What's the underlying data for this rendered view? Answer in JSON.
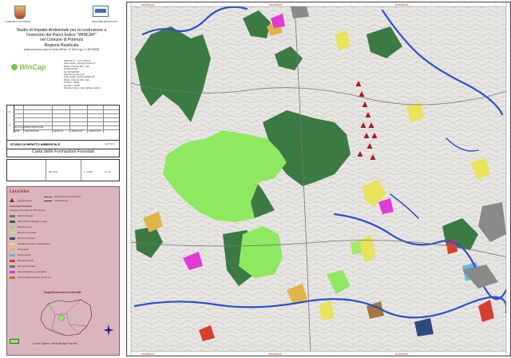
{
  "header": {
    "left_logo_caption": "COMUNE DI POTENZA",
    "right_logo_caption": "REGIONE BASILICATA",
    "title_lines": [
      "Studio di Impatto Ambientale per la costruzione e",
      "l'esercizio del Parco Eolico \"WINCAP\"",
      "nel Comune di Potenza",
      "Regione Basilicata"
    ],
    "title_sub": "(autorizzazione unica ai sensi dell'art. 12 del D.Lgs. n. 387/2003)"
  },
  "company": {
    "logo_text": "WinCap",
    "lines": [
      "WINCAP S.r.l. - EYA GROUP",
      "Sede Legale:   Via Pietro Fiorucci 8",
      "85100 - Potenza (PZ) - Italy",
      "Tel 0971/27697",
      "Fax 0971/27698",
      "",
      "Engineering Group Srl",
      "Sede Legale:   Via del Gallitello 89",
      "85100 - Potenza (PZ) - Italy",
      "Tel 0971 - 54201",
      "Fax 0971 - 50407",
      "Direttore Tecnico:  Dott. Raffaele Santoro"
    ]
  },
  "title_block": {
    "side_marks": [
      "0",
      "A"
    ],
    "rows": [
      {
        "date": "Marzo 2012",
        "desc": "PRIMA EMISSIONE"
      }
    ],
    "columns": [
      "DATA",
      "DESCRIZIONE",
      "REDATTO",
      "VERIFICATO",
      "APPROVATO"
    ],
    "doc_label": "STUDIO DI IMPATTO AMBIENTALE",
    "doc_code": "A.17.3.1",
    "drawing_title": "Carta delle Formazioni Forestali",
    "bottom": {
      "format": "594 x 841",
      "scale": "1 : 25.000",
      "sheet": "01 / 01"
    }
  },
  "legend": {
    "heading": "LEGENDA",
    "turbine_label": "Aerogeneratori",
    "forest_heading": "Formazioni Forestali",
    "forest_subheading": "Categorie Forestali del IFN Lucania",
    "items": [
      {
        "label": "Boschi di faggio",
        "color": "#4a8c3e"
      },
      {
        "label": "Altri boschi di latifoglie e misti",
        "color": "#2f6b34"
      },
      {
        "label": "Boschi di cerro",
        "color": "#8fd96b"
      },
      {
        "label": "Boschi di roverella",
        "color": "#a6e86a"
      },
      {
        "label": "Boschi di conifere",
        "color": "#2e4a7d"
      },
      {
        "label": "Arbusteti termofili e mediterranei",
        "color": "#e7e35a"
      },
      {
        "label": "Cespuglieti",
        "color": "#e0b449"
      },
      {
        "label": "Boschi igrofili",
        "color": "#5fb8e0"
      },
      {
        "label": "Rimboschimenti",
        "color": "#d63f2f"
      },
      {
        "label": "Formazioni riparie",
        "color": "#6f6f6f"
      },
      {
        "label": "Pascoli arborati e cespugliati",
        "color": "#e23ad6"
      },
      {
        "label": "Aree boscate percorse da incendi",
        "color": "#a07840"
      }
    ],
    "right_items": [
      "Elettrodotto interrato 36 kV",
      "Sottostazione"
    ],
    "inquadramento": "Inquadramento territoriale",
    "coord_system": "Coord. System: Gauss Boaga Fuso est"
  },
  "map_frame": {
    "top_labels": [
      "2570000.000",
      "2572000.000",
      "2574000.000"
    ],
    "bottom_labels": [
      "2570000.000",
      "2572000.000",
      "2574000.000"
    ],
    "left_labels": [
      "4506000.000",
      "4504000.000",
      "4502000.000",
      "4500000.000"
    ]
  },
  "colors": {
    "legend_bg": "#d9b6be",
    "turbine": "#a31c1c",
    "forest_light": "#8ee860",
    "forest_dark": "#3c7a44",
    "river": "#2d4fc9",
    "road": "#f0c030"
  }
}
